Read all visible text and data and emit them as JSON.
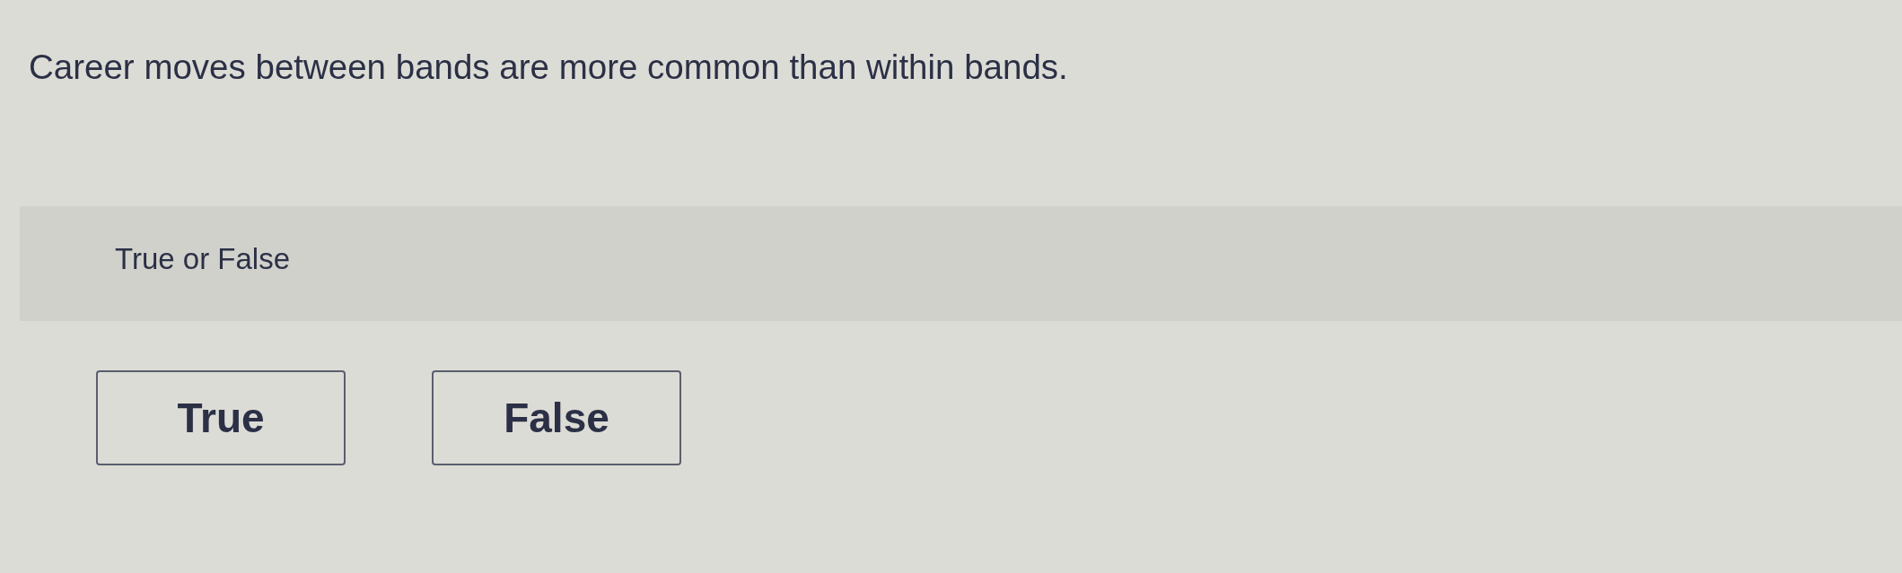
{
  "question": {
    "text": "Career moves between bands are more common than within bands."
  },
  "prompt": {
    "label": "True or False"
  },
  "choices": [
    {
      "label": "True",
      "selected": false
    },
    {
      "label": "False",
      "selected": false
    }
  ]
}
